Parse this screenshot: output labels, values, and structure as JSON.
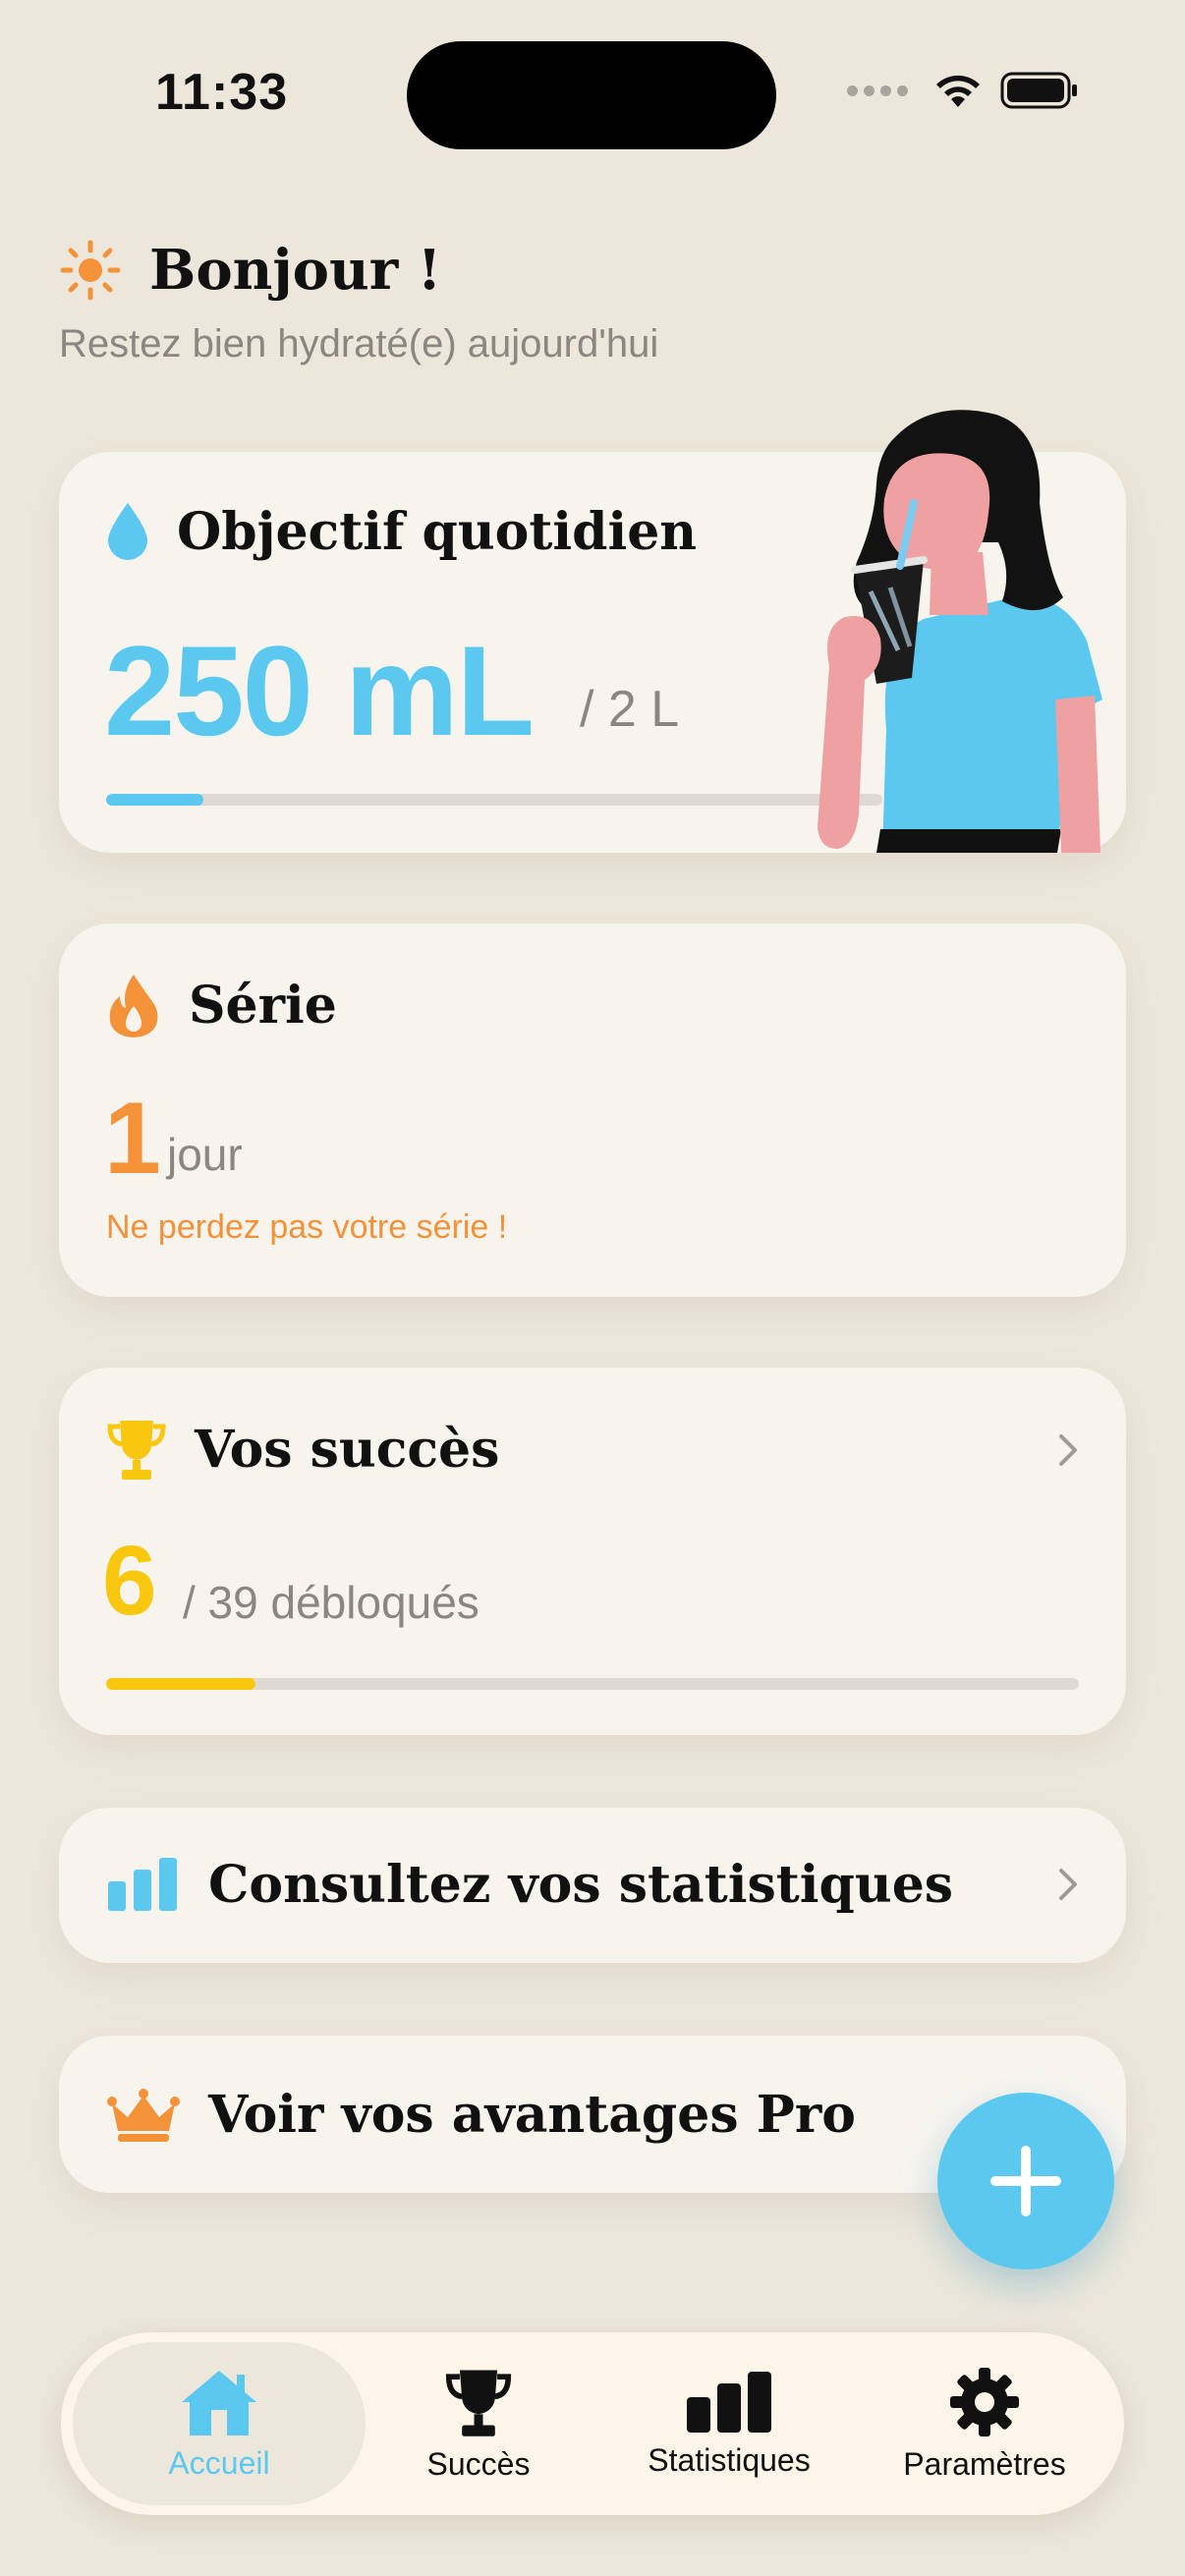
{
  "status_bar": {
    "time": "11:33"
  },
  "header": {
    "title": "Bonjour !",
    "subtitle": "Restez bien hydraté(e) aujourd'hui"
  },
  "goal_card": {
    "title": "Objectif quotidien",
    "value": "250 mL",
    "target": "/ 2 L",
    "progress": 0.125
  },
  "streak_card": {
    "title": "Série",
    "value": "1",
    "unit": "jour",
    "message": "Ne perdez pas votre série !"
  },
  "success_card": {
    "title": "Vos succès",
    "value": "6",
    "total_text": "/ 39 débloqués",
    "progress": 0.154
  },
  "stats_card": {
    "title": "Consultez vos statistiques"
  },
  "pro_card": {
    "title": "Voir vos avantages Pro"
  },
  "tab_bar": {
    "items": [
      {
        "label": "Accueil",
        "icon": "house-icon",
        "active": true
      },
      {
        "label": "Succès",
        "icon": "trophy-icon",
        "active": false
      },
      {
        "label": "Statistiques",
        "icon": "bar-chart-icon",
        "active": false
      },
      {
        "label": "Paramètres",
        "icon": "gear-icon",
        "active": false
      }
    ]
  },
  "colors": {
    "background": "#EDE7DB",
    "card": "#F7F4EE",
    "water": "#5BC8EF",
    "streak": "#F4923A",
    "success": "#F9C80E",
    "muted": "#8A8680"
  }
}
